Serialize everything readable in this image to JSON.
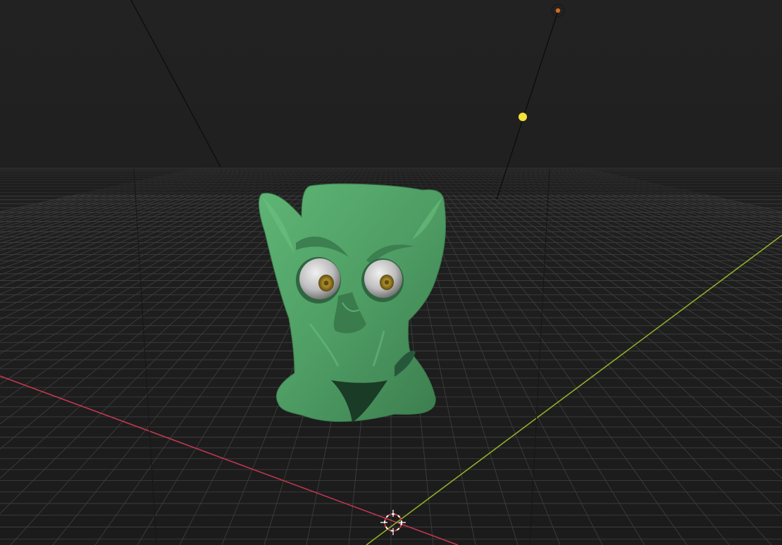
{
  "viewport": {
    "background": "#1d1d1d",
    "grid_color": "#3d3d3d",
    "x_axis_color": "#c0384f",
    "y_axis_color": "#8fae2a"
  },
  "scene": {
    "objects": [
      {
        "name": "sculpted-head",
        "color": "#4f9e65"
      },
      {
        "name": "left-eye",
        "color": "#d8d8d8",
        "iris_color": "#9a7d24"
      },
      {
        "name": "right-eye",
        "color": "#d8d8d8",
        "iris_color": "#9a7d24"
      },
      {
        "name": "point-light",
        "color": "#f2e23a"
      },
      {
        "name": "sun-light",
        "color": "#d06a1e"
      }
    ],
    "icons": {
      "cursor": "3d-cursor-icon"
    }
  }
}
